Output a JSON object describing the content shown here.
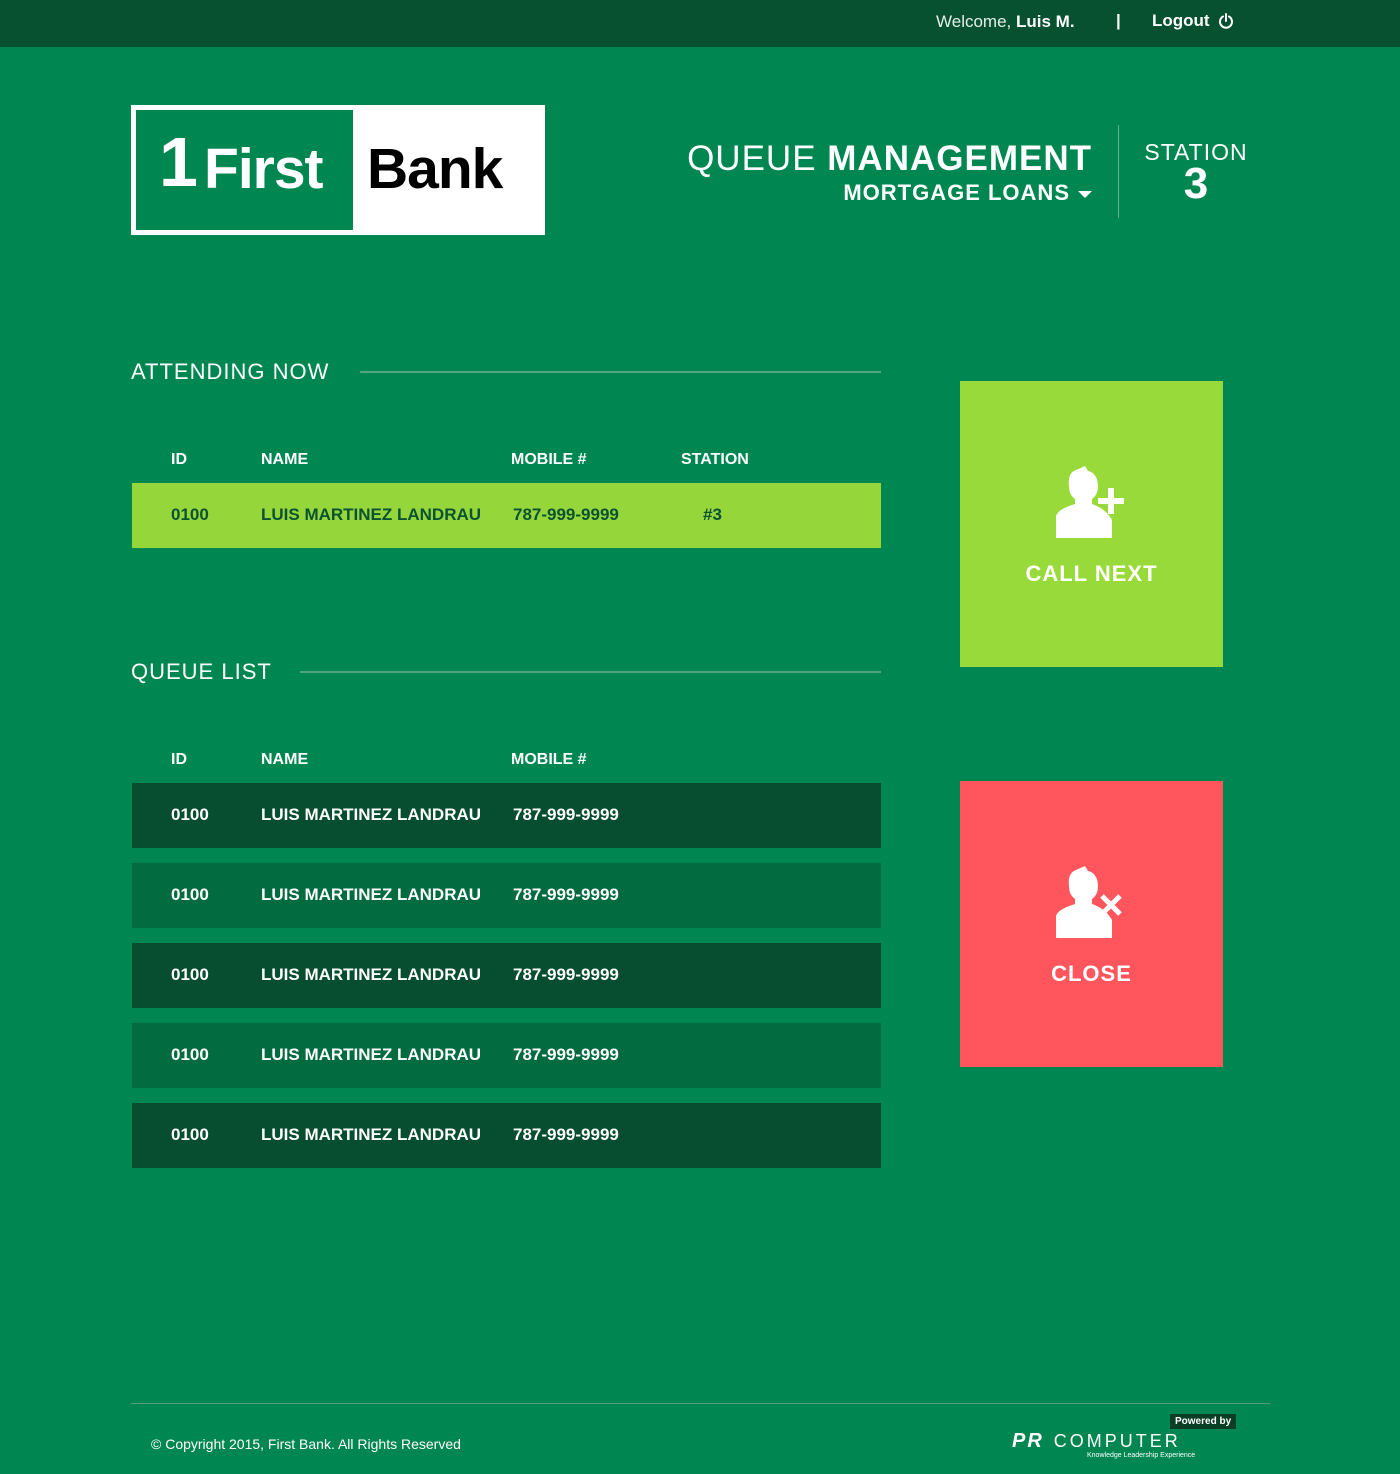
{
  "header": {
    "welcome_prefix": "Welcome,",
    "user_name": "Luis M.",
    "separator": "|",
    "logout_label": "Logout",
    "logout_icon": "power-icon"
  },
  "logo": {
    "one": "1",
    "first": "First",
    "bank": "Bank"
  },
  "title": {
    "queue": "QUEUE",
    "management": "MANAGEMENT",
    "department": "MORTGAGE LOANS",
    "station_label": "STATION",
    "station_number": "3"
  },
  "attending": {
    "heading": "ATTENDING NOW",
    "columns": {
      "id": "ID",
      "name": "NAME",
      "mobile": "MOBILE #",
      "station": "STATION"
    },
    "row": {
      "id": "0100",
      "name": "LUIS MARTINEZ LANDRAU",
      "mobile": "787-999-9999",
      "station": "#3"
    }
  },
  "queue": {
    "heading": "QUEUE LIST",
    "columns": {
      "id": "ID",
      "name": "NAME",
      "mobile": "MOBILE #"
    },
    "rows": [
      {
        "id": "0100",
        "name": "LUIS MARTINEZ LANDRAU",
        "mobile": "787-999-9999"
      },
      {
        "id": "0100",
        "name": "LUIS MARTINEZ LANDRAU",
        "mobile": "787-999-9999"
      },
      {
        "id": "0100",
        "name": "LUIS MARTINEZ LANDRAU",
        "mobile": "787-999-9999"
      },
      {
        "id": "0100",
        "name": "LUIS MARTINEZ LANDRAU",
        "mobile": "787-999-9999"
      },
      {
        "id": "0100",
        "name": "LUIS MARTINEZ LANDRAU",
        "mobile": "787-999-9999"
      }
    ]
  },
  "actions": {
    "call_next": {
      "label": "CALL NEXT",
      "icon": "add-user-icon",
      "color": "#98da3a"
    },
    "close": {
      "label": "CLOSE",
      "icon": "remove-user-icon",
      "color": "#ff555c"
    }
  },
  "footer": {
    "copyright": "© Copyright 2015, First Bank. All Rights Reserved",
    "powered_by": "Powered by",
    "vendor_pr": "PR",
    "vendor_computer": "COMPUTER",
    "vendor_tagline": "Knowledge Leadership Experience"
  },
  "colors": {
    "background": "#008751",
    "topbar": "#075130",
    "attending_row": "#95d63a",
    "row_dark": "#074d2f",
    "row_mid": "#026b40"
  }
}
